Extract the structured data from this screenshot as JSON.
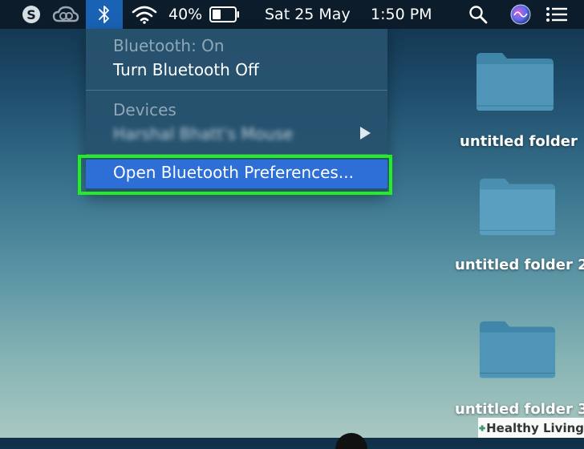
{
  "menubar": {
    "battery_percent": "40%",
    "battery_level": 0.4,
    "date": "Sat 25 May",
    "time": "1:50 PM",
    "icons": [
      "skype-icon",
      "creative-cloud-icon",
      "bluetooth-icon",
      "wifi-icon",
      "battery-icon",
      "spotlight-search-icon",
      "siri-icon",
      "notification-center-icon"
    ]
  },
  "bluetooth_menu": {
    "status": "Bluetooth: On",
    "toggle_label": "Turn Bluetooth Off",
    "devices_header": "Devices",
    "device_name": "Harshal Bhatt's Mouse",
    "open_prefs_label": "Open Bluetooth Preferences..."
  },
  "desktop": {
    "folders": [
      {
        "label": "untitled folder"
      },
      {
        "label": "untitled folder 2"
      },
      {
        "label": "untitled folder 3"
      }
    ]
  },
  "watermark": {
    "text": "Healthy Living"
  },
  "colors": {
    "menubar_bg": "#0c1c2a",
    "bluetooth_active_bg": "#1a63b4",
    "menu_bg": "#28526e",
    "selected_item_bg": "#2d6fd6",
    "highlight_frame": "#22ee22",
    "folder_blue": "#4f95b8"
  }
}
